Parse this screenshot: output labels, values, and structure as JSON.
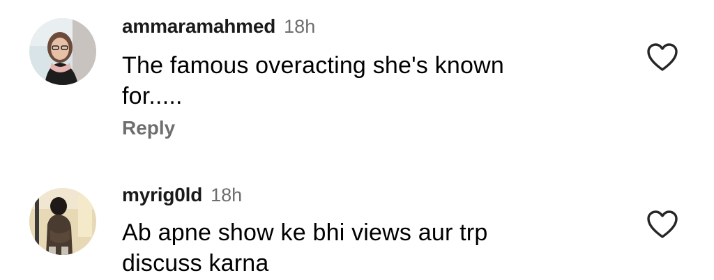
{
  "comments": [
    {
      "username": "ammaramahmed",
      "time": "18h",
      "text_lines": [
        "The famous overacting she's known",
        "for....."
      ],
      "reply_label": "Reply",
      "avatar_icon": "user-photo-avatar",
      "like_icon": "heart-outline-icon"
    },
    {
      "username": "myrig0ld",
      "time": "18h",
      "text_lines": [
        "Ab apne show ke bhi views aur trp",
        "discuss karna"
      ],
      "like_icon": "heart-outline-icon",
      "avatar_icon": "user-photo-avatar"
    }
  ],
  "colors": {
    "username": "#1a1a1a",
    "meta": "#6e6e6e",
    "text": "#000000",
    "background": "#ffffff"
  }
}
